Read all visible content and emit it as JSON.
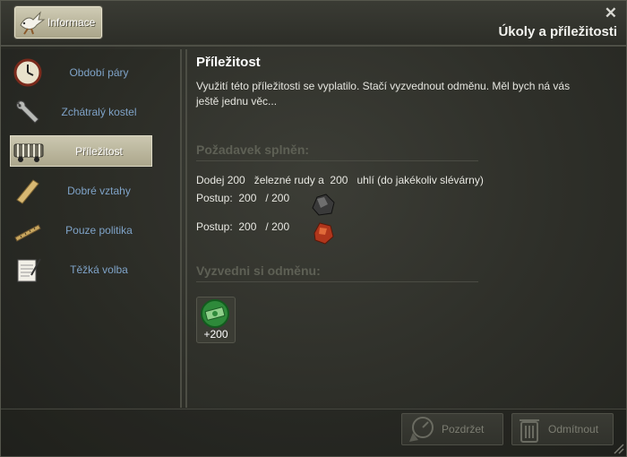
{
  "window": {
    "title": "Úkoly a příležitosti",
    "info_button": "Informace",
    "close_glyph": "✕"
  },
  "sidebar": {
    "items": [
      {
        "label": "Období páry",
        "icon": "clock-icon",
        "active": false
      },
      {
        "label": "Zchátralý kostel",
        "icon": "wrench-icon",
        "active": false
      },
      {
        "label": "Příležitost",
        "icon": "wagon-icon",
        "active": true
      },
      {
        "label": "Dobré vztahy",
        "icon": "plank-icon",
        "active": false
      },
      {
        "label": "Pouze politika",
        "icon": "ruler-icon",
        "active": false
      },
      {
        "label": "Těžká volba",
        "icon": "notepad-icon",
        "active": false
      }
    ]
  },
  "main": {
    "heading": "Příležitost",
    "description": "Využití této příležitosti se vyplatilo. Stačí vyzvednout odměnu. Měl bych ná vás ještě jednu věc...",
    "requirement_title": "Požadavek splněn:",
    "task_text": "Dodej 200   železné rudy a  200   uhlí (do jakékoliv slévárny)",
    "progress": [
      {
        "label": "Postup:",
        "current": "200",
        "total": "/ 200",
        "icon": "coal-icon"
      },
      {
        "label": "Postup:",
        "current": "200",
        "total": "/ 200",
        "icon": "iron-ore-icon"
      }
    ],
    "reward_title": "Vyzvedni si odměnu:",
    "reward": {
      "value": "+200",
      "icon": "money-icon"
    }
  },
  "footer": {
    "postpone": "Pozdržet",
    "decline": "Odmítnout"
  },
  "colors": {
    "background": "#2e2f29",
    "nav_label": "#7fa3c8",
    "active_tab": "#bdb89e",
    "section_heading": "#5e6055"
  }
}
